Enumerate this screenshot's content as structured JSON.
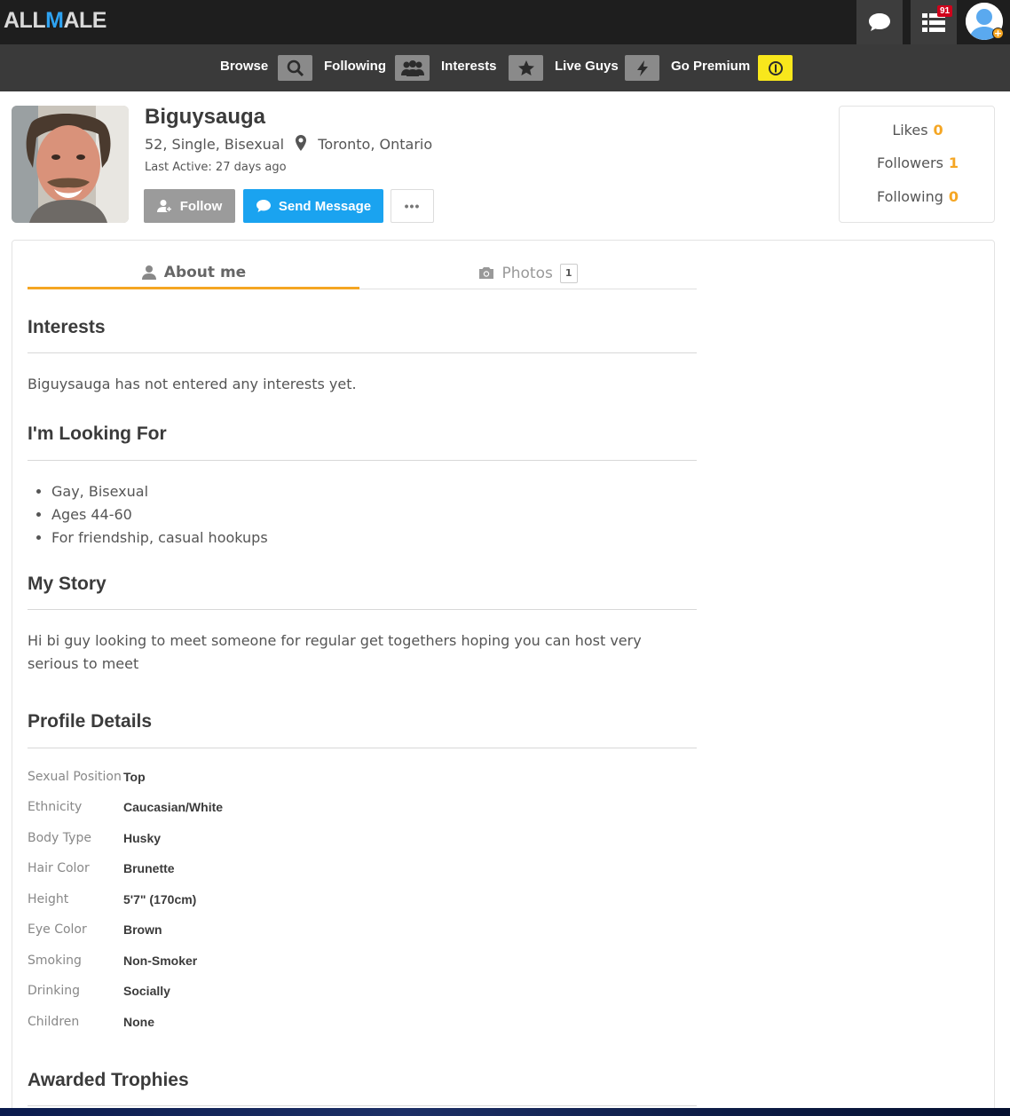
{
  "topbar": {
    "logo_part1": "ALL",
    "logo_part2": "M",
    "logo_part3": "ALE",
    "notifications_count": "91"
  },
  "nav": {
    "browse": "Browse",
    "following": "Following",
    "interests": "Interests",
    "live_guys": "Live Guys",
    "go_premium": "Go Premium"
  },
  "profile": {
    "username": "Biguysauga",
    "summary": "52, Single, Bisexual",
    "location": "Toronto, Ontario",
    "last_active": "Last Active: 27 days ago",
    "follow_label": "Follow",
    "message_label": "Send Message",
    "more_label": "•••"
  },
  "stats": {
    "likes_label": "Likes",
    "likes": "0",
    "followers_label": "Followers",
    "followers": "1",
    "following_label": "Following",
    "following": "0"
  },
  "tabs": {
    "about": "About me",
    "photos": "Photos",
    "photos_count": "1"
  },
  "sections": {
    "interests_title": "Interests",
    "interests_text": "Biguysauga has not entered any interests yet.",
    "looking_title": "I'm Looking For",
    "looking_items": [
      "Gay, Bisexual",
      "Ages 44-60",
      "For friendship, casual hookups"
    ],
    "story_title": "My Story",
    "story_text": "Hi bi guy looking to meet someone for regular get togethers hoping you can host very serious to meet",
    "details_title": "Profile Details",
    "trophies_title": "Awarded Trophies"
  },
  "details": [
    {
      "label": "Sexual Position",
      "value": "Top"
    },
    {
      "label": "Ethnicity",
      "value": "Caucasian/White"
    },
    {
      "label": "Body Type",
      "value": "Husky"
    },
    {
      "label": "Hair Color",
      "value": "Brunette"
    },
    {
      "label": "Height",
      "value": "5'7\" (170cm)"
    },
    {
      "label": "Eye Color",
      "value": "Brown"
    },
    {
      "label": "Smoking",
      "value": "Non-Smoker"
    },
    {
      "label": "Drinking",
      "value": "Socially"
    },
    {
      "label": "Children",
      "value": "None"
    }
  ],
  "colors": {
    "accent_orange": "#f5a623",
    "message_blue": "#1aa3f0",
    "premium_yellow": "#f8e71c",
    "logo_blue": "#2ea3f2"
  },
  "icons": [
    "chat-bubble-icon",
    "list-icon",
    "user-avatar-icon",
    "search-icon",
    "users-group-icon",
    "star-icon",
    "lightning-icon",
    "coin-icon",
    "map-pin-icon",
    "user-plus-icon",
    "user-icon",
    "camera-icon"
  ]
}
